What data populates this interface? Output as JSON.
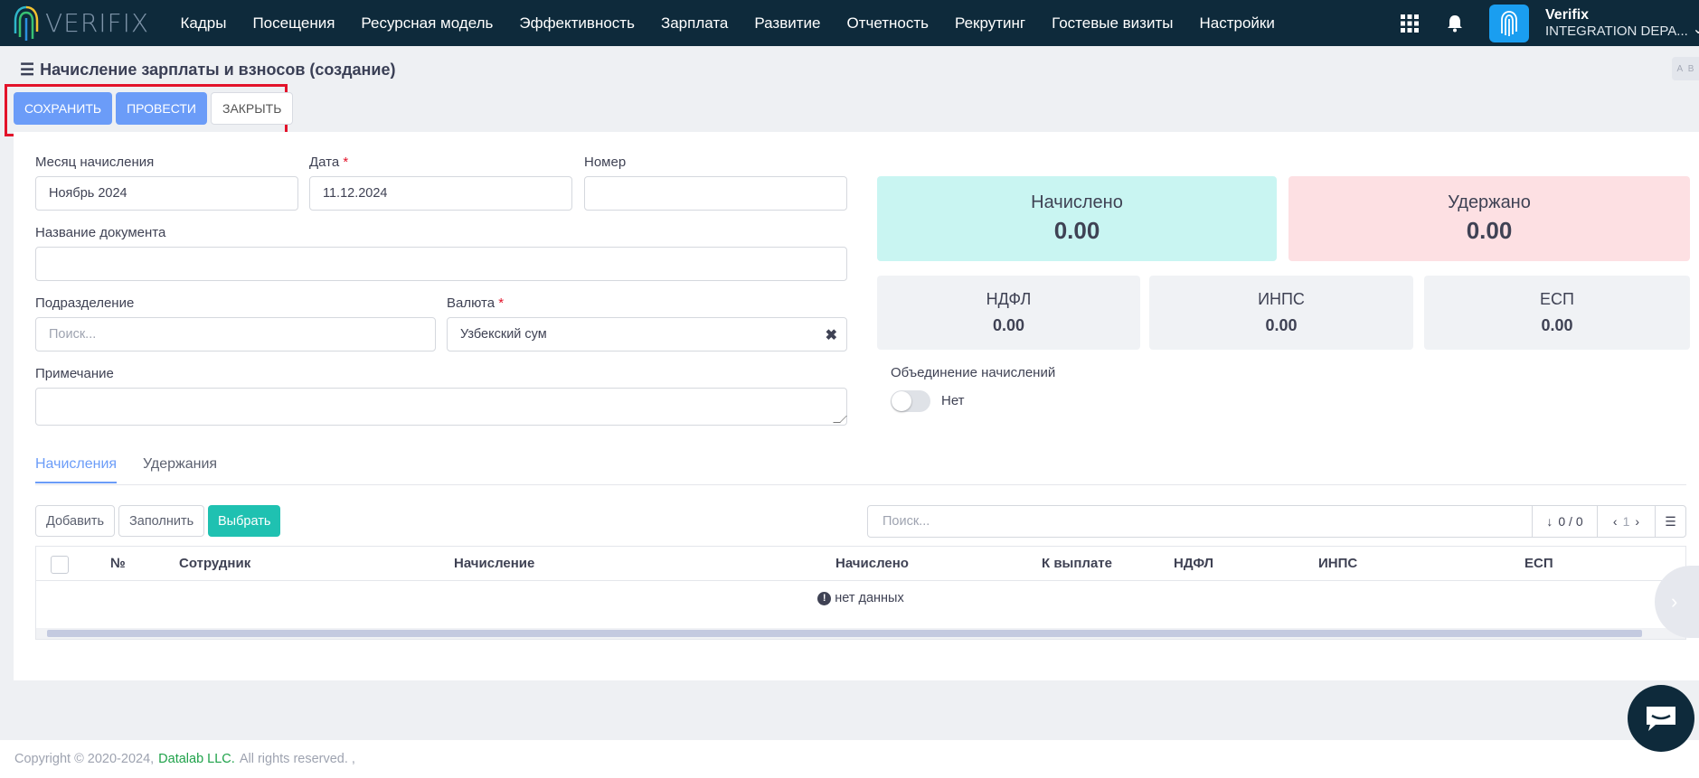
{
  "topbar": {
    "logo_text": "VERIFIX",
    "nav": [
      "Кадры",
      "Посещения",
      "Ресурсная модель",
      "Эффективность",
      "Зарплата",
      "Развитие",
      "Отчетность",
      "Рекрутинг",
      "Гостевые визиты",
      "Настройки"
    ],
    "user_name": "Verifix",
    "user_dept": "INTEGRATION DEPA..."
  },
  "page": {
    "title": "Начисление зарплаты и взносов (создание)",
    "lang_label": "A  B",
    "buttons": {
      "save": "СОХРАНИТЬ",
      "post": "ПРОВЕСТИ",
      "close": "ЗАКРЫТЬ"
    }
  },
  "form": {
    "month_label": "Месяц начисления",
    "month_value": "Ноябрь 2024",
    "date_label": "Дата",
    "date_value": "11.12.2024",
    "number_label": "Номер",
    "number_value": "",
    "docname_label": "Название документа",
    "docname_value": "",
    "division_label": "Подразделение",
    "division_placeholder": "Поиск...",
    "currency_label": "Валюта",
    "currency_value": "Узбекский сум",
    "required_mark": "*",
    "note_label": "Примечание",
    "note_value": ""
  },
  "stats": {
    "accrued_label": "Начислено",
    "accrued_value": "0.00",
    "accrued_color": "#c9f5f2",
    "withheld_label": "Удержано",
    "withheld_value": "0.00",
    "withheld_color": "#fde0e3",
    "ndfl_label": "НДФЛ",
    "ndfl_value": "0.00",
    "inps_label": "ИНПС",
    "inps_value": "0.00",
    "esp_label": "ЕСП",
    "esp_value": "0.00"
  },
  "merge": {
    "label": "Объединение начислений",
    "state": "Нет"
  },
  "tabs": {
    "accruals": "Начисления",
    "deductions": "Удержания"
  },
  "grid": {
    "add": "Добавить",
    "fill": "Заполнить",
    "select": "Выбрать",
    "search_placeholder": "Поиск...",
    "count": "0 / 0",
    "page": "1",
    "columns": [
      "№",
      "Сотрудник",
      "Начисление",
      "Начислено",
      "К выплате",
      "НДФЛ",
      "ИНПС",
      "ЕСП"
    ],
    "empty_text": "нет данных"
  },
  "footer": {
    "copyright": "Copyright © 2020-2024,",
    "brand": "Datalab LLC.",
    "rights": "All rights reserved. ,"
  }
}
